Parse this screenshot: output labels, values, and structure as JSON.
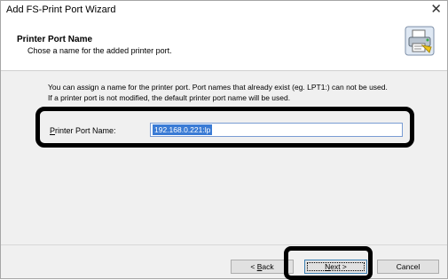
{
  "window": {
    "title": "Add FS-Print Port Wizard",
    "close_glyph": "✕"
  },
  "header": {
    "title": "Printer Port Name",
    "subtitle": "Chose a name for the added printer port.",
    "icon": "printer-wizard-icon"
  },
  "body": {
    "description_line1": "You can assign a name for the printer port. Port names that already exist (eg. LPT1:) can not be used.",
    "description_line2": "If a printer port is not modified, the default printer port name will be used.",
    "port_name_label_mnemonic": "P",
    "port_name_label_rest": "rinter Port Name:",
    "port_name_value": "192.168.0.221:lp"
  },
  "buttons": {
    "back_prefix": "< ",
    "back_mnemonic": "B",
    "back_rest": "ack",
    "next_mnemonic": "N",
    "next_rest": "ext >",
    "cancel": "Cancel"
  },
  "colors": {
    "selection": "#3a7bd5",
    "annotation": "#000000"
  }
}
